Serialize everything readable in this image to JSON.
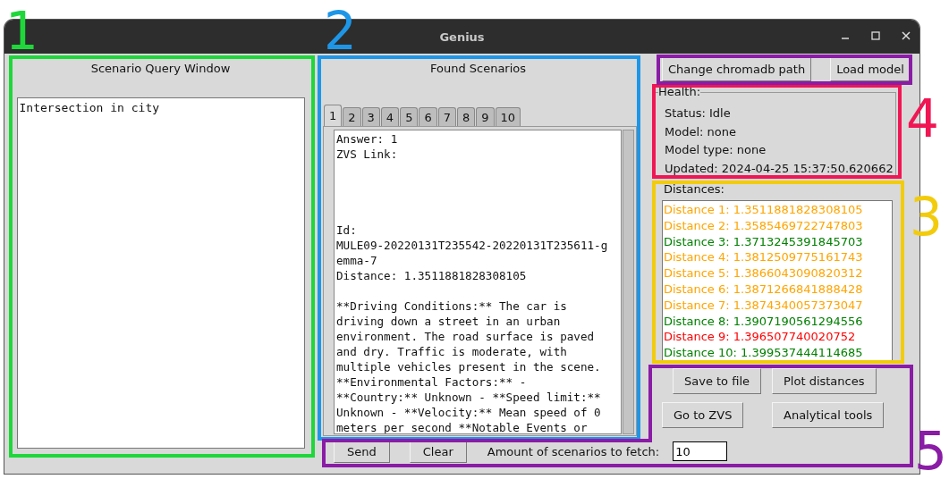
{
  "window": {
    "title": "Genius"
  },
  "query_panel": {
    "title": "Scenario Query Window",
    "query": "Intersection in city"
  },
  "scenarios_panel": {
    "title": "Found Scenarios",
    "tabs": [
      {
        "label": "1",
        "selected": true
      },
      {
        "label": "2",
        "selected": false
      },
      {
        "label": "3",
        "selected": false
      },
      {
        "label": "4",
        "selected": false
      },
      {
        "label": "5",
        "selected": false
      },
      {
        "label": "6",
        "selected": false
      },
      {
        "label": "7",
        "selected": false
      },
      {
        "label": "8",
        "selected": false
      },
      {
        "label": "9",
        "selected": false
      },
      {
        "label": "10",
        "selected": false
      }
    ],
    "answer_blocks": [
      [
        "Answer: 1",
        "ZVS Link:"
      ],
      [
        "Id:",
        "MULE09-20220131T235542-20220131T235611-g",
        "emma-7",
        "Distance: 1.3511881828308105"
      ],
      [
        "**Driving Conditions:** The car is",
        "driving down a street in an urban",
        "environment. The road surface is paved",
        "and dry. Traffic is moderate, with",
        "multiple vehicles present in the scene.",
        "**Environmental Factors:** -",
        "**Country:** Unknown - **Speed limit:**",
        "Unknown - **Velocity:** Mean speed of 0",
        "meters per second **Notable Events or"
      ]
    ]
  },
  "top_buttons": [
    "Change chromadb path",
    "Load model"
  ],
  "health": {
    "title": "Health:",
    "lines": [
      "Status: Idle",
      "Model: none",
      "Model type: none",
      "Updated: 2024-04-25 15:37:50.620662"
    ]
  },
  "distances": {
    "title": "Distances:",
    "items": [
      {
        "text": "Distance 1: 1.3511881828308105",
        "color": "#ffa500"
      },
      {
        "text": "Distance 2: 1.3585469722747803",
        "color": "#ffa500"
      },
      {
        "text": "Distance 3: 1.3713245391845703",
        "color": "#008000"
      },
      {
        "text": "Distance 4: 1.3812509775161743",
        "color": "#ffa500"
      },
      {
        "text": "Distance 5: 1.3866043090820312",
        "color": "#ffa500"
      },
      {
        "text": "Distance 6: 1.3871266841888428",
        "color": "#ffa500"
      },
      {
        "text": "Distance 7: 1.3874340057373047",
        "color": "#ffa500"
      },
      {
        "text": "Distance 8: 1.3907190561294556",
        "color": "#008000"
      },
      {
        "text": "Distance 9: 1.396507740020752",
        "color": "#ff0000"
      },
      {
        "text": "Distance 10: 1.399537444114685",
        "color": "#008000"
      }
    ]
  },
  "action_buttons": [
    "Save to file",
    "Plot distances",
    "Go to ZVS",
    "Analytical tools"
  ],
  "bottom_bar": {
    "buttons": [
      "Send",
      "Clear"
    ],
    "fetch_label": "Amount of scenarios to fetch:",
    "fetch_value": "10"
  },
  "annotations": [
    {
      "label": "1",
      "color": "#1ed73a"
    },
    {
      "label": "2",
      "color": "#1e96e8"
    },
    {
      "label": "4",
      "color": "#f01654"
    },
    {
      "label": "3",
      "color": "#f2cc0c"
    },
    {
      "label": "5",
      "color": "#8a1ca6"
    }
  ]
}
